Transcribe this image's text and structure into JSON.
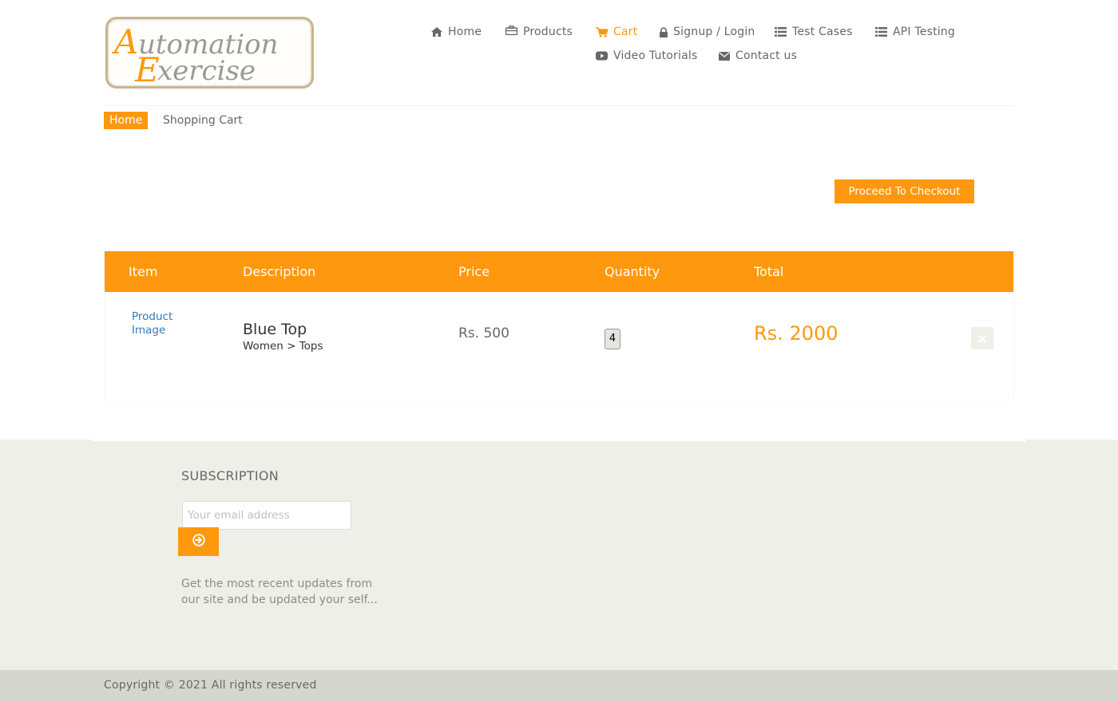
{
  "header": {
    "logo_text_line1": "Automation",
    "logo_text_line2": "Exercise"
  },
  "nav": {
    "items": [
      {
        "label": "Home",
        "icon": "home-icon"
      },
      {
        "label": "Products",
        "icon": "briefcase-icon"
      },
      {
        "label": "Cart",
        "icon": "shopping-cart-icon",
        "active": true
      },
      {
        "label": "Signup / Login",
        "icon": "lock-icon"
      },
      {
        "label": "Test Cases",
        "icon": "list-icon"
      },
      {
        "label": "API Testing",
        "icon": "list-icon"
      },
      {
        "label": "Video Tutorials",
        "icon": "youtube-play-icon"
      },
      {
        "label": "Contact us",
        "icon": "envelope-icon"
      }
    ]
  },
  "breadcrumb": {
    "home": "Home",
    "current": "Shopping Cart"
  },
  "checkout": {
    "label": "Proceed To Checkout"
  },
  "cart": {
    "headers": [
      "Item",
      "Description",
      "Price",
      "Quantity",
      "Total"
    ],
    "rows": [
      {
        "image_alt": "Product Image",
        "name": "Blue Top",
        "category": "Women > Tops",
        "price": "Rs. 500",
        "quantity": "4",
        "total": "Rs. 2000"
      }
    ]
  },
  "subscription": {
    "title": "SUBSCRIPTION",
    "placeholder": "Your email address",
    "text": "Get the most recent updates from our site and be updated your self..."
  },
  "footer": {
    "copyright": "Copyright © 2021 All rights reserved"
  },
  "colors": {
    "accent": "#FE980F",
    "text": "#696763",
    "footer_bg": "#EFEFE9",
    "footer_bottom_bg": "#D6D6D0"
  }
}
